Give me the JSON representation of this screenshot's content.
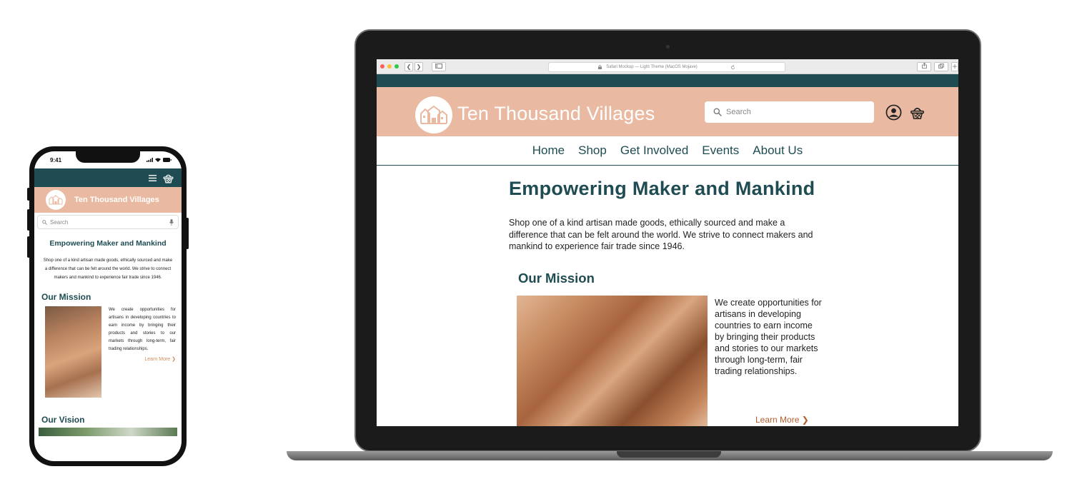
{
  "phone": {
    "status": {
      "time": "9:41"
    },
    "brand": {
      "name": "Ten Thousand Villages"
    },
    "search": {
      "placeholder": "Search"
    },
    "hero": {
      "title": "Empowering Maker and Mankind",
      "intro": "Shop one of a kind artisan made goods, ethically sourced and make a difference that can be felt around the world. We strive to connect makers and mankind to experience fair trade since 1946."
    },
    "mission": {
      "heading": "Our Mission",
      "text": "We create opportunities for artisans in developing countries to earn income by bringing their products and stories to our markets through long-term, fair trading relationships.",
      "learn_more": "Learn More ❯"
    },
    "vision": {
      "heading": "Our Vision"
    },
    "icons": [
      "menu-icon",
      "basket-icon",
      "search-icon",
      "mic-icon",
      "signal-icon",
      "wifi-icon",
      "battery-icon"
    ]
  },
  "browser": {
    "url": "Safari Mockup — Light Theme (MacOS Mojave)",
    "back": "❮",
    "forward": "❯"
  },
  "site": {
    "brand": {
      "name": "Ten Thousand Villages"
    },
    "search": {
      "placeholder": "Search"
    },
    "nav": [
      "Home",
      "Shop",
      "Get Involved",
      "Events",
      "About Us"
    ],
    "hero": {
      "title": "Empowering Maker and Mankind",
      "intro": "Shop one of a kind artisan made goods, ethically sourced and make a difference that can be felt around the world. We strive to connect makers and mankind to experience fair trade since 1946."
    },
    "mission": {
      "heading": "Our Mission",
      "text": "We create opportunities for artisans in developing countries to earn income by bringing their products and stories to our markets through long-term, fair trading relationships.",
      "learn_more": "Learn More ❯"
    },
    "colors": {
      "teal": "#1e4c52",
      "peach": "#e9b9a1",
      "accent": "#b35d2c"
    }
  }
}
